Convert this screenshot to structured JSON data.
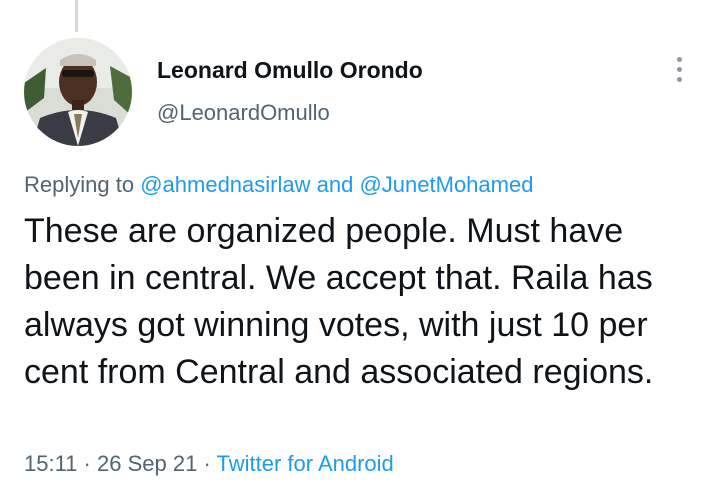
{
  "author": {
    "display_name": "Leonard Omullo Orondo",
    "handle": "@LeonardOmullo"
  },
  "reply_context": {
    "prefix": "Replying to",
    "mention_1": "@ahmednasirlaw",
    "connector": "and",
    "mention_2": "@JunetMohamed"
  },
  "tweet": {
    "text": "These are organized people. Must have been in central. We accept that. Raila has always got winning votes, with just 10 per cent from Central and associated regions."
  },
  "meta": {
    "time": "15:11",
    "separator": "·",
    "date": "26 Sep 21",
    "source": "Twitter for Android"
  },
  "icons": {
    "more": "more-vertical-icon"
  },
  "colors": {
    "link": "#1d9bf0",
    "secondary_text": "#536471",
    "primary_text": "#0f1419"
  }
}
